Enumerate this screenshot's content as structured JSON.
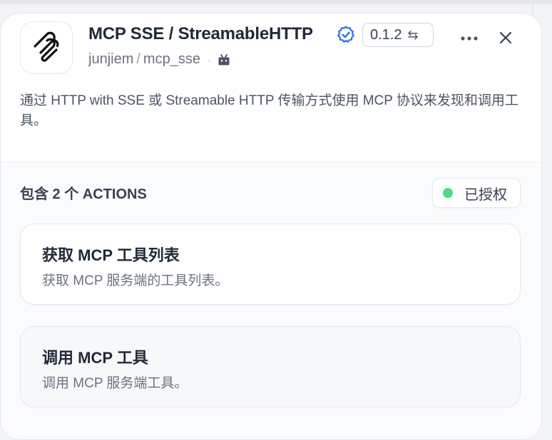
{
  "plugin": {
    "title": "MCP SSE / StreamableHTTP",
    "version": "0.1.2",
    "owner": "junjiem",
    "repo": "mcp_sse",
    "separator": "/",
    "dot": "·",
    "description": "通过 HTTP with SSE 或 Streamable HTTP 传输方式使用 MCP 协议来发现和调用工具。"
  },
  "icons": {
    "logo": "mcp-logo-icon",
    "verified": "verified-badge-icon",
    "version_swap": "⇆",
    "more": "more-options-icon",
    "close": "close-icon",
    "repo_type": "robot-icon"
  },
  "actions": {
    "heading": "包含 2 个 ACTIONS",
    "auth_label": "已授权",
    "items": [
      {
        "title": "获取 MCP 工具列表",
        "description": "获取 MCP 服务端的工具列表。"
      },
      {
        "title": "调用 MCP 工具",
        "description": "调用 MCP 服务端工具。"
      }
    ]
  },
  "colors": {
    "verified_blue": "#2f6fed",
    "auth_green": "#4ade80"
  }
}
